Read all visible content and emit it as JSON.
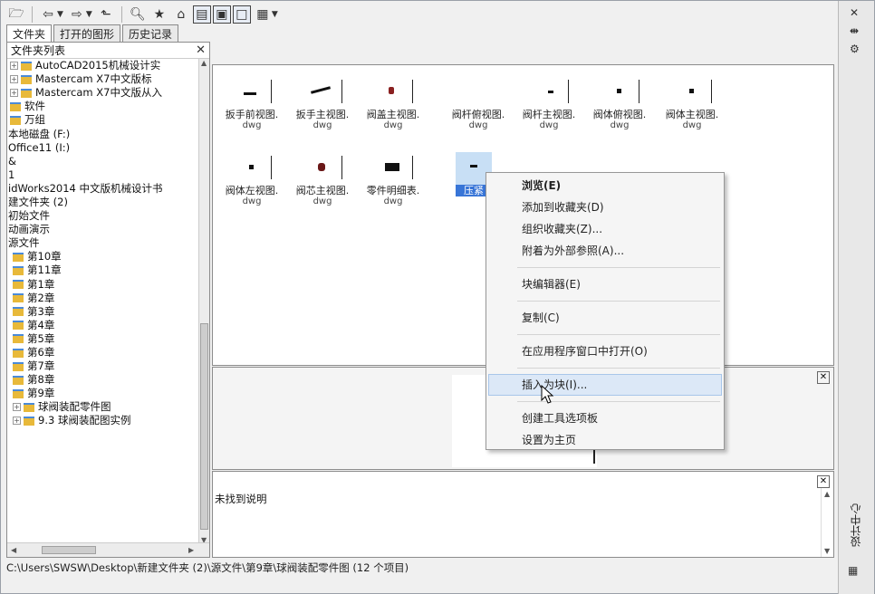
{
  "toolbar": {
    "icons": [
      "load-icon",
      "back-icon",
      "forward-icon",
      "up-folder-icon",
      "search-icon",
      "favorites-icon",
      "home-icon",
      "tree-view-toggle-icon",
      "favorites-view-toggle-icon",
      "preview-toggle-icon",
      "views-icon"
    ]
  },
  "tabs": [
    {
      "label": "文件夹"
    },
    {
      "label": "打开的图形"
    },
    {
      "label": "历史记录"
    }
  ],
  "tree": {
    "header": "文件夹列表",
    "items": [
      {
        "label": "AutoCAD2015机械设计实"
      },
      {
        "label": "Mastercam X7中文版标"
      },
      {
        "label": "Mastercam X7中文版从入"
      },
      {
        "label": "软件"
      },
      {
        "label": "万组"
      },
      {
        "label": "本地磁盘 (F:)"
      },
      {
        "label": "Office11 (I:)"
      },
      {
        "label": "&"
      },
      {
        "label": "1"
      },
      {
        "label": "idWorks2014 中文版机械设计书"
      },
      {
        "label": "建文件夹 (2)"
      },
      {
        "label": "初始文件"
      },
      {
        "label": "动画演示"
      },
      {
        "label": "源文件"
      },
      {
        "label": "第10章"
      },
      {
        "label": "第11章"
      },
      {
        "label": "第1章"
      },
      {
        "label": "第2章"
      },
      {
        "label": "第3章"
      },
      {
        "label": "第4章"
      },
      {
        "label": "第5章"
      },
      {
        "label": "第6章"
      },
      {
        "label": "第7章"
      },
      {
        "label": "第8章"
      },
      {
        "label": "第9章"
      },
      {
        "label": "球阀装配零件图"
      },
      {
        "label": "9.3  球阀装配图实例"
      }
    ]
  },
  "thumbnails": [
    {
      "name": "扳手前视图.",
      "ext": "dwg"
    },
    {
      "name": "扳手主视图.",
      "ext": "dwg"
    },
    {
      "name": "阀盖主视图.",
      "ext": "dwg"
    },
    {
      "name": "阀杆俯视图.",
      "ext": "dwg"
    },
    {
      "name": "阀杆主视图.",
      "ext": "dwg"
    },
    {
      "name": "阀体俯视图.",
      "ext": "dwg"
    },
    {
      "name": "阀体主视图.",
      "ext": "dwg"
    },
    {
      "name": "阀体左视图.",
      "ext": "dwg"
    },
    {
      "name": "阀芯主视图.",
      "ext": "dwg"
    },
    {
      "name": "零件明细表.",
      "ext": "dwg"
    },
    {
      "name": "压紧",
      "ext": ""
    }
  ],
  "context_menu": {
    "items": [
      {
        "label": "浏览(E)",
        "bold": true
      },
      {
        "label": "添加到收藏夹(D)"
      },
      {
        "label": "组织收藏夹(Z)..."
      },
      {
        "label": "附着为外部参照(A)..."
      },
      {
        "label": "块编辑器(E)"
      },
      {
        "label": "复制(C)"
      },
      {
        "label": "在应用程序窗口中打开(O)"
      },
      {
        "label": "插入为块(I)..."
      },
      {
        "label": "创建工具选项板"
      },
      {
        "label": "设置为主页"
      }
    ]
  },
  "description": {
    "text": "未找到说明"
  },
  "status": {
    "path": "C:\\Users\\SWSW\\Desktop\\新建文件夹 (2)\\源文件\\第9章\\球阀装配零件图  (12 个项目)"
  },
  "window": {
    "title": "设计中心"
  }
}
